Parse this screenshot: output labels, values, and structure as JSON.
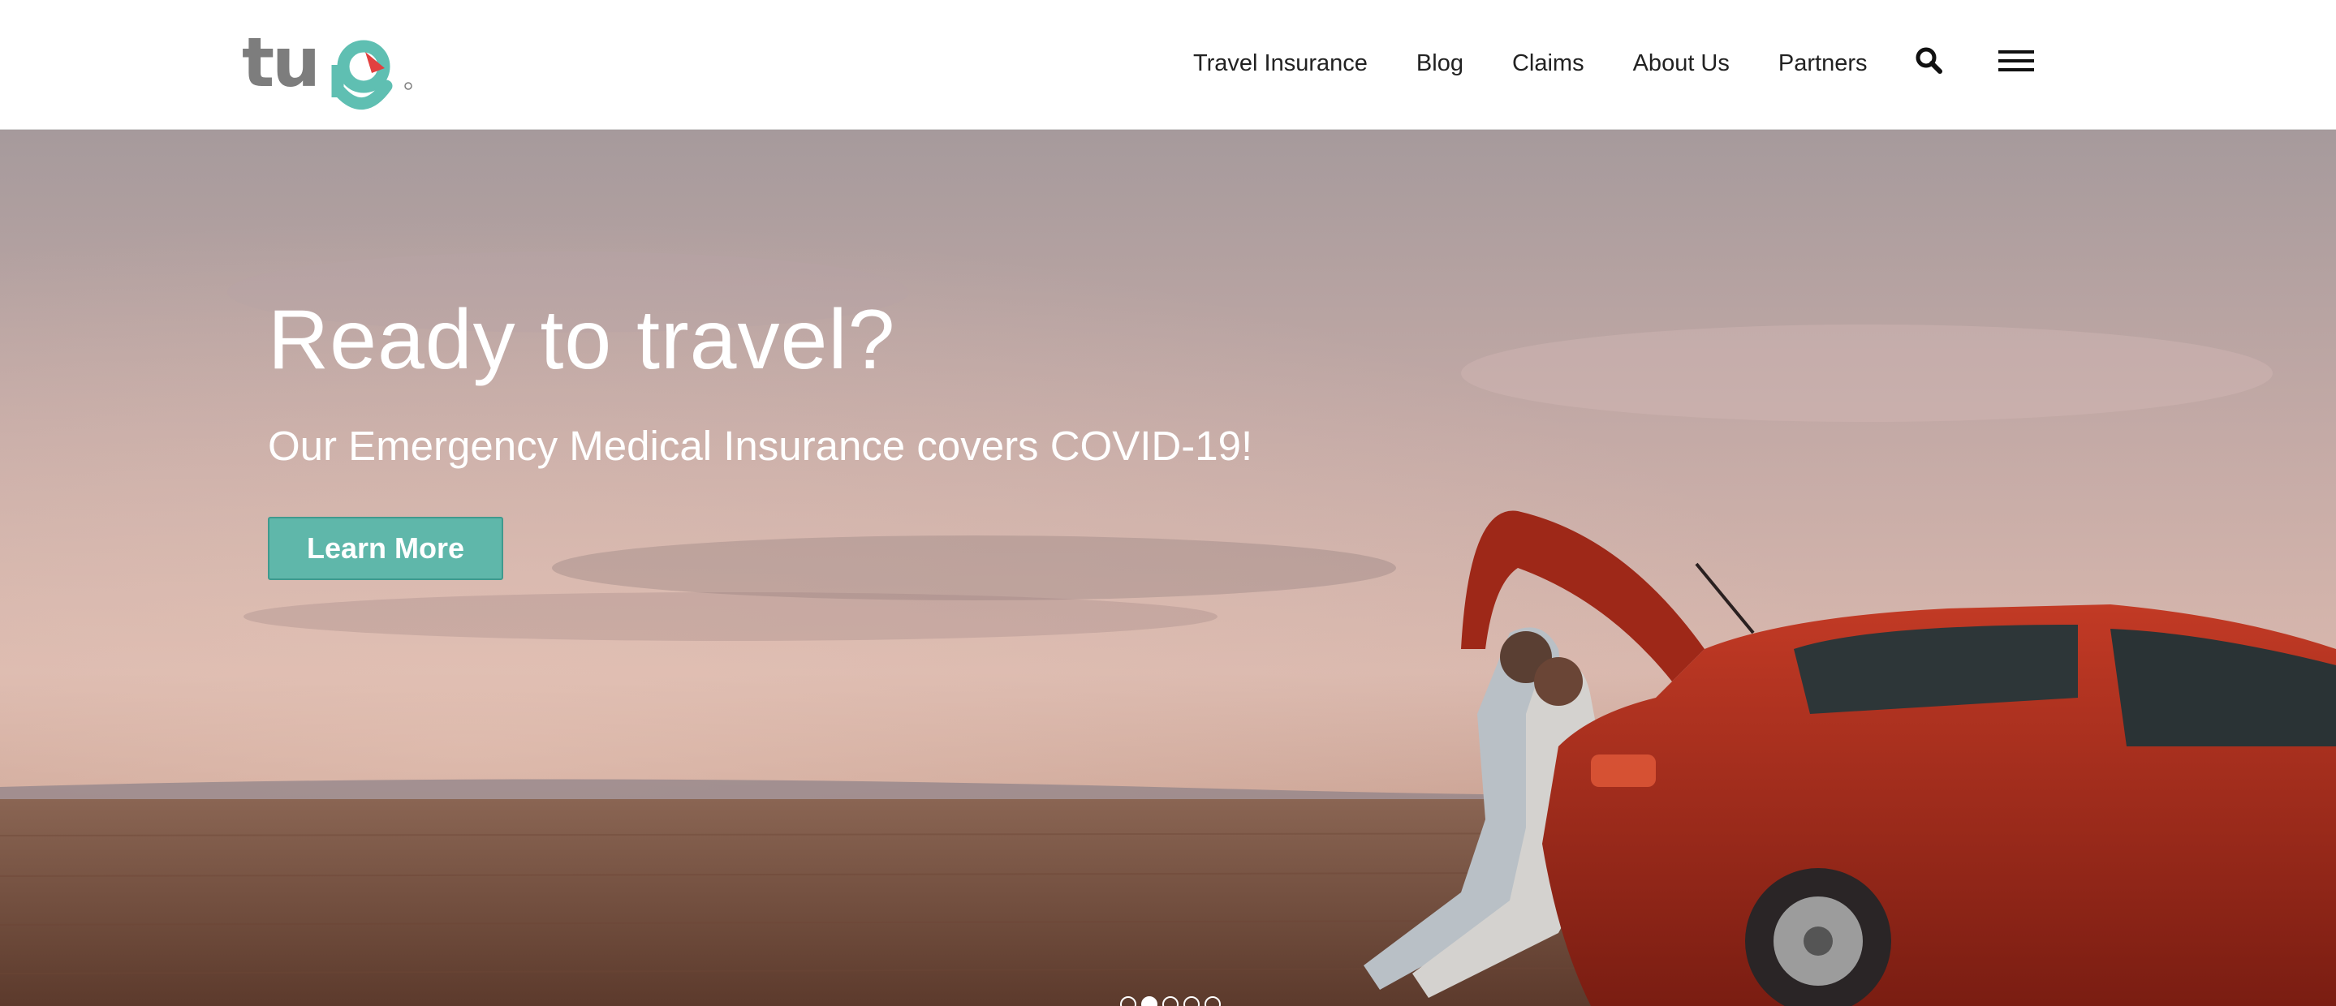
{
  "brand": {
    "logo_text": "tugo",
    "logo_gray": "#7d7d7d",
    "logo_teal": "#5fbfb2",
    "logo_red": "#e2403f"
  },
  "nav": {
    "items": [
      {
        "label": "Travel Insurance"
      },
      {
        "label": "Blog"
      },
      {
        "label": "Claims"
      },
      {
        "label": "About Us"
      },
      {
        "label": "Partners"
      }
    ],
    "search_icon": "search-icon",
    "menu_icon": "hamburger-menu-icon"
  },
  "hero": {
    "title": "Ready to travel?",
    "subtitle": "Our Emergency Medical Insurance covers COVID-19!",
    "cta_label": "Learn More",
    "cta_color": "#5fb7aa"
  },
  "carousel": {
    "total_slides": 5,
    "active_slide": 2
  }
}
